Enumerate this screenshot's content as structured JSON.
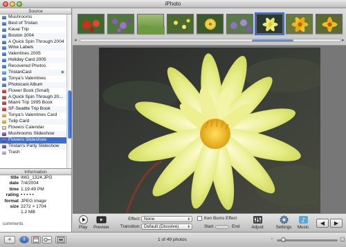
{
  "window": {
    "title": "iPhoto"
  },
  "source": {
    "header": "Source",
    "items": [
      {
        "label": "Mushrooms",
        "icon": "album-icon"
      },
      {
        "label": "Best of Tristan",
        "icon": "album-icon"
      },
      {
        "label": "Kauai Trip",
        "icon": "album-icon"
      },
      {
        "label": "Boston 2004",
        "icon": "album-icon"
      },
      {
        "label": "A Quick Spin Through 2004",
        "icon": "album-icon"
      },
      {
        "label": "Wine Labels",
        "icon": "album-icon"
      },
      {
        "label": "Valentines 2005",
        "icon": "album-icon"
      },
      {
        "label": "Holiday Card 2005",
        "icon": "album-icon"
      },
      {
        "label": "Recovered Photos",
        "icon": "album-icon"
      },
      {
        "label": "TristanCast",
        "icon": "photocast-icon"
      },
      {
        "label": "Tonya's Valentines",
        "icon": "album-icon"
      },
      {
        "label": "Photocast Album",
        "icon": "album-icon"
      },
      {
        "label": "Flower Book (Small)",
        "icon": "book-icon"
      },
      {
        "label": "A Quick Spin Through 20...",
        "icon": "book-icon"
      },
      {
        "label": "Miami Trip 1995 Book",
        "icon": "book-icon"
      },
      {
        "label": "SF-Seattle Trip Book",
        "icon": "book-icon"
      },
      {
        "label": "Tonya's Valentines Card",
        "icon": "card-icon"
      },
      {
        "label": "Tulip Card",
        "icon": "card-icon"
      },
      {
        "label": "Flowers Calendar",
        "icon": "calendar-icon"
      },
      {
        "label": "Mushrooms Slideshow",
        "icon": "slideshow-icon"
      },
      {
        "label": "Flowers Slideshow",
        "icon": "slideshow-icon",
        "selected": true
      },
      {
        "label": "Tristan's Party Slideshow",
        "icon": "slideshow-icon"
      },
      {
        "label": "Trash",
        "icon": "trash-icon"
      }
    ]
  },
  "information": {
    "header": "Information",
    "title_label": "title",
    "title_value": "IMG_1324.JPG",
    "date_label": "date",
    "date_value": "7/4/2004",
    "time_label": "time",
    "time_value": "1:19:49 PM",
    "rating_label": "rating",
    "rating_value": "• • • • •",
    "format_label": "format",
    "format_value": "JPEG image",
    "size_label": "size",
    "size_value": "2272 × 1704",
    "filesize_value": "1.2 MB",
    "comments_label": "comments"
  },
  "filmstrip": {
    "thumbnails": [
      {
        "name": "flower-thumb-red",
        "selected": false
      },
      {
        "name": "flower-thumb-purple",
        "selected": false
      },
      {
        "name": "flower-thumb-green",
        "selected": false
      },
      {
        "name": "flower-thumb-yellow-small",
        "selected": false
      },
      {
        "name": "flower-thumb-yellow-bloom",
        "selected": false
      },
      {
        "name": "flower-thumb-purple-field",
        "selected": false
      },
      {
        "name": "flower-thumb-waterlily",
        "selected": true
      },
      {
        "name": "flower-thumb-yellow-large",
        "selected": false
      },
      {
        "name": "flower-thumb-yellow-last",
        "selected": false
      }
    ]
  },
  "controls": {
    "play_label": "Play",
    "preview_label": "Preview",
    "effect_label": "Effect:",
    "effect_value": "None",
    "transition_label": "Transition:",
    "transition_value": "Default (Dissolve)",
    "ken_burns_label": "Ken Burns Effect",
    "start_label": "Start",
    "end_label": "End",
    "adjust_label": "Adjust",
    "settings_label": "Settings",
    "music_label": "Music"
  },
  "status": {
    "photo_count": "1 of 49 photos"
  },
  "colors": {
    "selection": "#3d6fd0",
    "window_bg": "#c9c9c9"
  }
}
